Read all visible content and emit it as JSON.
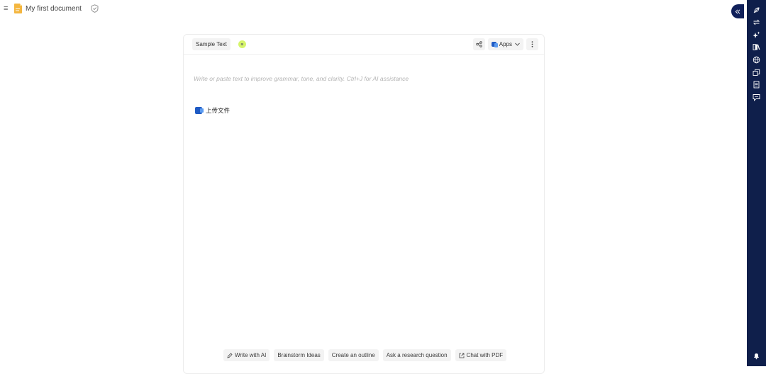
{
  "header": {
    "menu_glyph": "≡",
    "doc_title": "My first document"
  },
  "editor": {
    "sample_label": "Sample Text",
    "badge_glyph": "≋",
    "apps_label": "Apps",
    "placeholder": "Write or paste text to improve grammar, tone, and clarity. Ctrl+J for AI assistance",
    "upload_label": "上传文件"
  },
  "actions": [
    {
      "label": "Write with AI",
      "icon": "pen-sparkle-icon"
    },
    {
      "label": "Brainstorm Ideas"
    },
    {
      "label": "Create an outline"
    },
    {
      "label": "Ask a research question"
    },
    {
      "label": "Chat with PDF",
      "icon": "external-link-icon"
    }
  ],
  "sidebar_rail": {
    "icons": [
      "feather-icon",
      "swap-icon",
      "sparkles-icon",
      "library-icon",
      "globe-icon",
      "copy-icon",
      "book-icon",
      "chat-icon"
    ],
    "bottom_icon": "bell-icon"
  },
  "colors": {
    "rail": "#0f1f4b",
    "badge": "#d6f56b",
    "doc_icon": "#f4b63f",
    "word": "#1f5bc4"
  }
}
